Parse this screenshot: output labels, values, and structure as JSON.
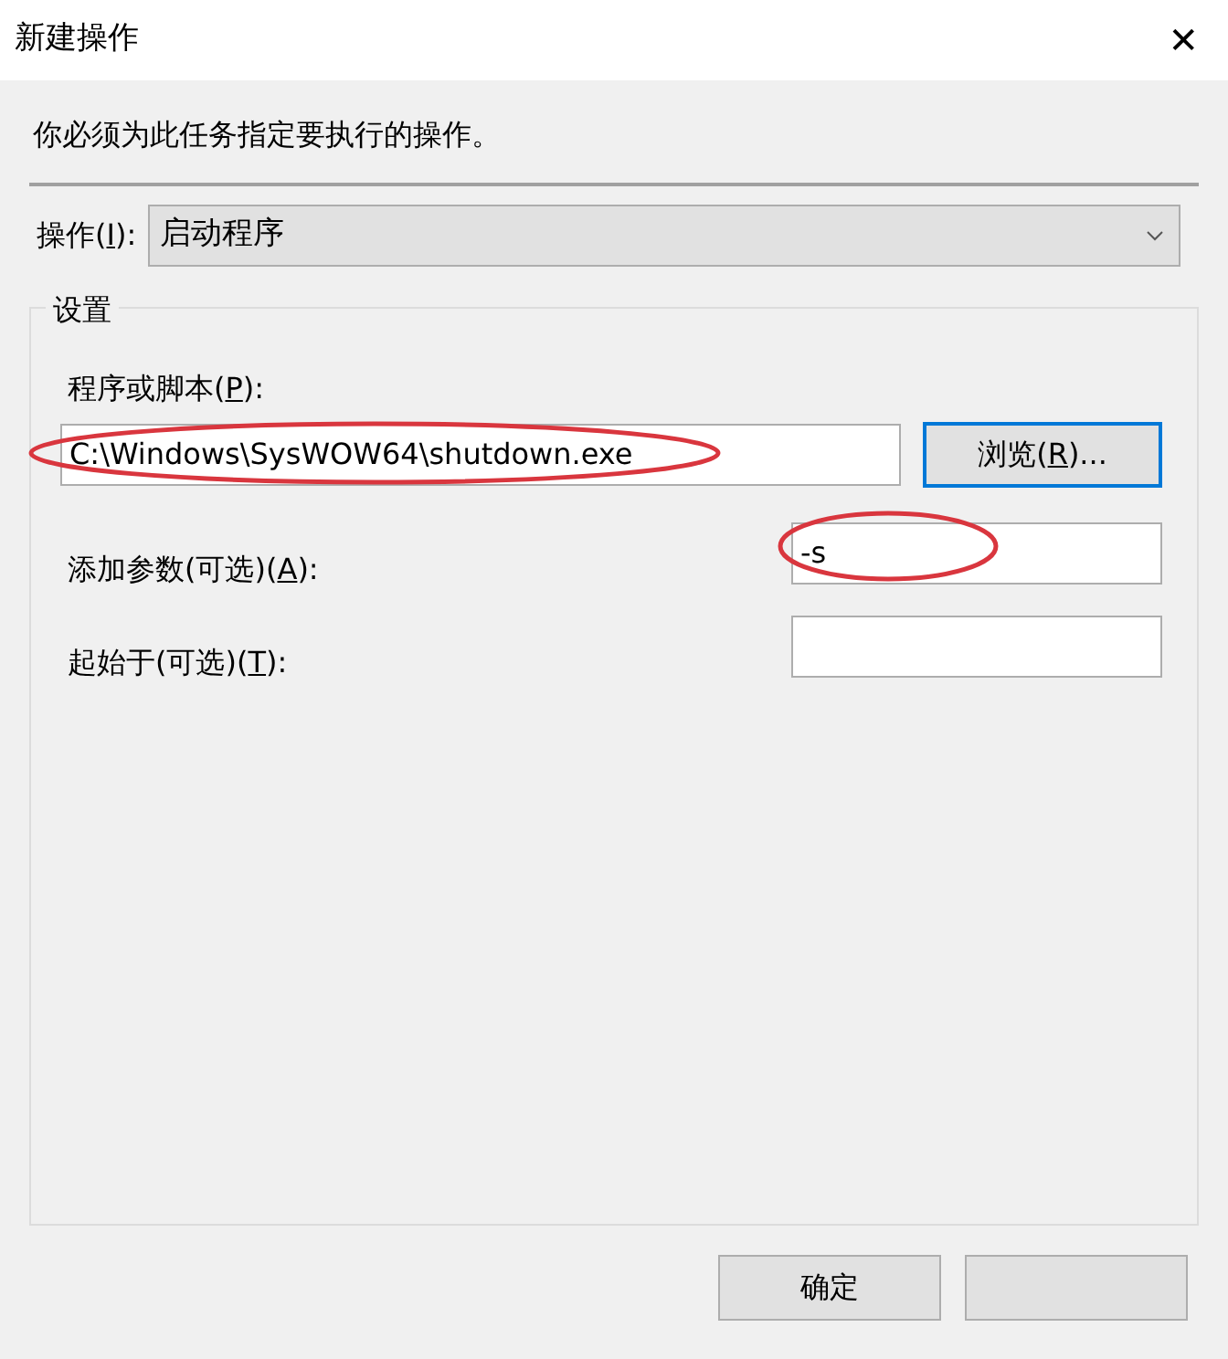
{
  "window": {
    "title": "新建操作",
    "close": "✕"
  },
  "instruction": "你必须为此任务指定要执行的操作。",
  "action": {
    "label": {
      "before": "操作(",
      "key": "I",
      "after": "):"
    },
    "value": "启动程序"
  },
  "settings": {
    "legend": "设置",
    "fields": [
      {
        "kind": "wide",
        "label": {
          "before": "程序或脚本(",
          "key": "P",
          "after": "):"
        },
        "value": "C:\\Windows\\SysWOW64\\shutdown.exe",
        "circled": true,
        "button": {
          "before": "浏览(",
          "key": "R",
          "after": ")...",
          "focused": true
        }
      },
      {
        "kind": "narrow",
        "label": {
          "before": "添加参数(可选)(",
          "key": "A",
          "after": "):"
        },
        "value": "-s",
        "circled": true
      },
      {
        "kind": "narrow",
        "label": {
          "before": "起始于(可选)(",
          "key": "T",
          "after": "):"
        },
        "circled": false
      }
    ]
  },
  "buttons": [
    {
      "kind": "labeled",
      "label": "确定"
    },
    {
      "kind": "covered"
    }
  ]
}
